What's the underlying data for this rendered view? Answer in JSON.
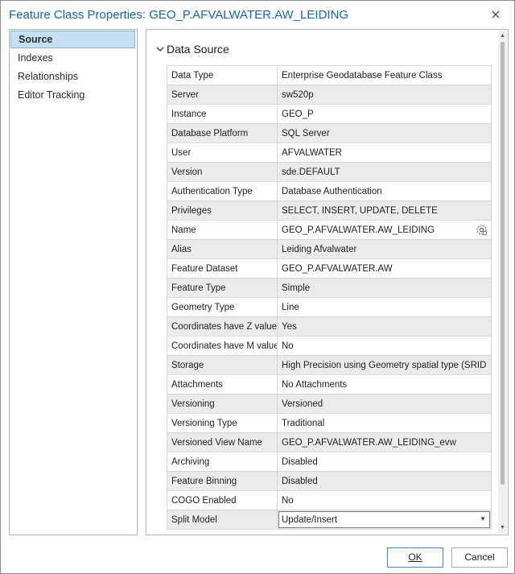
{
  "window": {
    "title": "Feature Class Properties: GEO_P.AFVALWATER.AW_LEIDING"
  },
  "sidebar": {
    "items": [
      {
        "label": "Source",
        "active": true
      },
      {
        "label": "Indexes",
        "active": false
      },
      {
        "label": "Relationships",
        "active": false
      },
      {
        "label": "Editor Tracking",
        "active": false
      }
    ]
  },
  "section": {
    "title": "Data Source"
  },
  "properties": [
    {
      "key": "Data Type",
      "value": "Enterprise Geodatabase Feature Class"
    },
    {
      "key": "Server",
      "value": "sw520p"
    },
    {
      "key": "Instance",
      "value": "GEO_P"
    },
    {
      "key": "Database Platform",
      "value": "SQL Server"
    },
    {
      "key": "User",
      "value": "AFVALWATER"
    },
    {
      "key": "Version",
      "value": "sde.DEFAULT"
    },
    {
      "key": "Authentication Type",
      "value": "Database Authentication"
    },
    {
      "key": "Privileges",
      "value": "SELECT, INSERT, UPDATE, DELETE"
    },
    {
      "key": "Name",
      "value": "GEO_P.AFVALWATER.AW_LEIDING"
    },
    {
      "key": "Alias",
      "value": "Leiding Afvalwater"
    },
    {
      "key": "Feature Dataset",
      "value": "GEO_P.AFVALWATER.AW"
    },
    {
      "key": "Feature Type",
      "value": "Simple"
    },
    {
      "key": "Geometry Type",
      "value": "Line"
    },
    {
      "key": "Coordinates have Z value",
      "value": "Yes"
    },
    {
      "key": "Coordinates have M value",
      "value": "No"
    },
    {
      "key": "Storage",
      "value": "High Precision using Geometry spatial type (SRID"
    },
    {
      "key": "Attachments",
      "value": "No Attachments"
    },
    {
      "key": "Versioning",
      "value": "Versioned"
    },
    {
      "key": "Versioning Type",
      "value": "Traditional"
    },
    {
      "key": "Versioned View Name",
      "value": "GEO_P.AFVALWATER.AW_LEIDING_evw"
    },
    {
      "key": "Archiving",
      "value": "Disabled"
    },
    {
      "key": "Feature Binning",
      "value": "Disabled"
    },
    {
      "key": "COGO Enabled",
      "value": "No"
    },
    {
      "key": "Split Model",
      "value": "Update/Insert"
    }
  ],
  "buttons": {
    "ok": "OK",
    "cancel": "Cancel"
  },
  "colors": {
    "title": "#1565b5",
    "active_item": "#c7dff5",
    "accent_border": "#3c8ad6"
  }
}
